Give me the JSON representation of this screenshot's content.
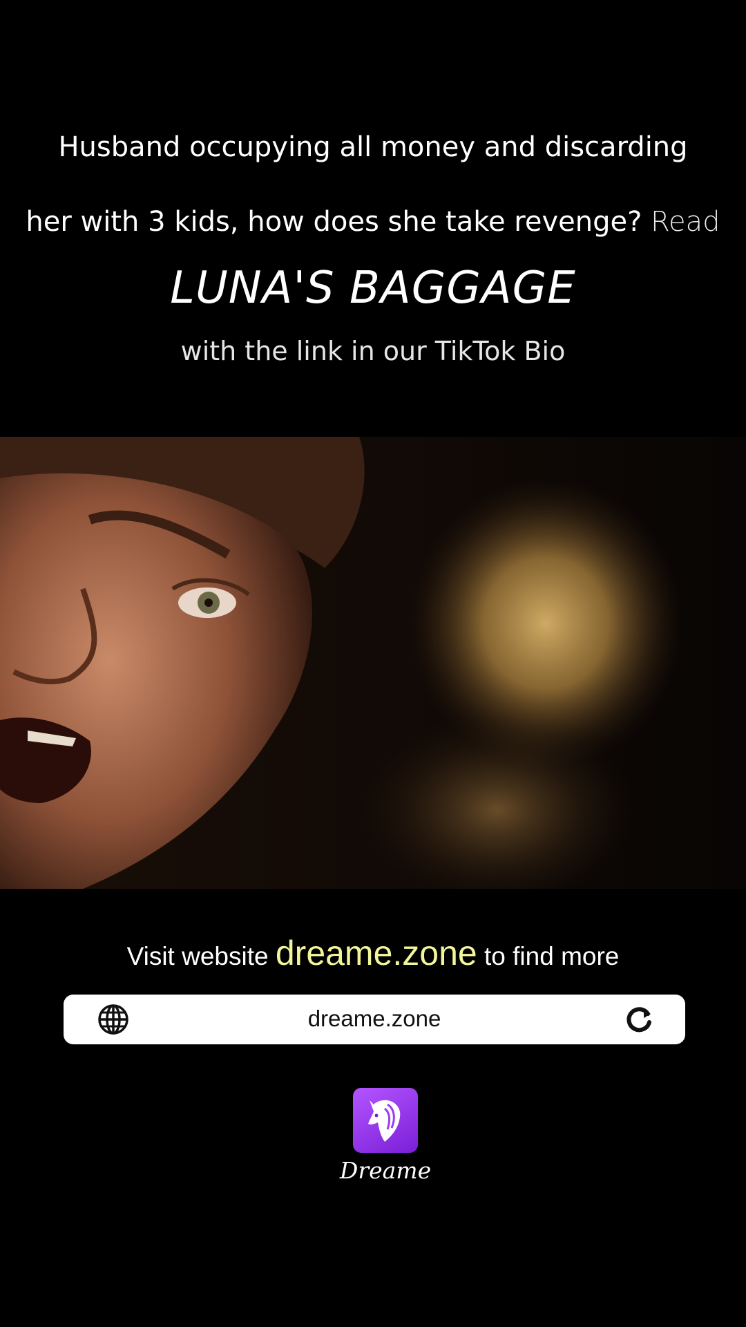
{
  "caption": {
    "line1": "Husband occupying all money and discarding",
    "line2": "her with 3 kids, how does she take revenge?",
    "read": "Read",
    "title": "LUNA'S BAGGAGE",
    "subtitle": "with the link in our TikTok Bio"
  },
  "promo": {
    "visit_prefix": "Visit website",
    "visit_domain": "dreame.zone",
    "visit_suffix": "to find more"
  },
  "urlbar": {
    "url": "dreame.zone",
    "left_icon": "globe-icon",
    "right_icon": "reload-icon"
  },
  "brand": {
    "name": "Dreame",
    "logo_icon": "unicorn-logo-icon",
    "accent": "#9b3cf0",
    "highlight": "#f3f59a"
  }
}
